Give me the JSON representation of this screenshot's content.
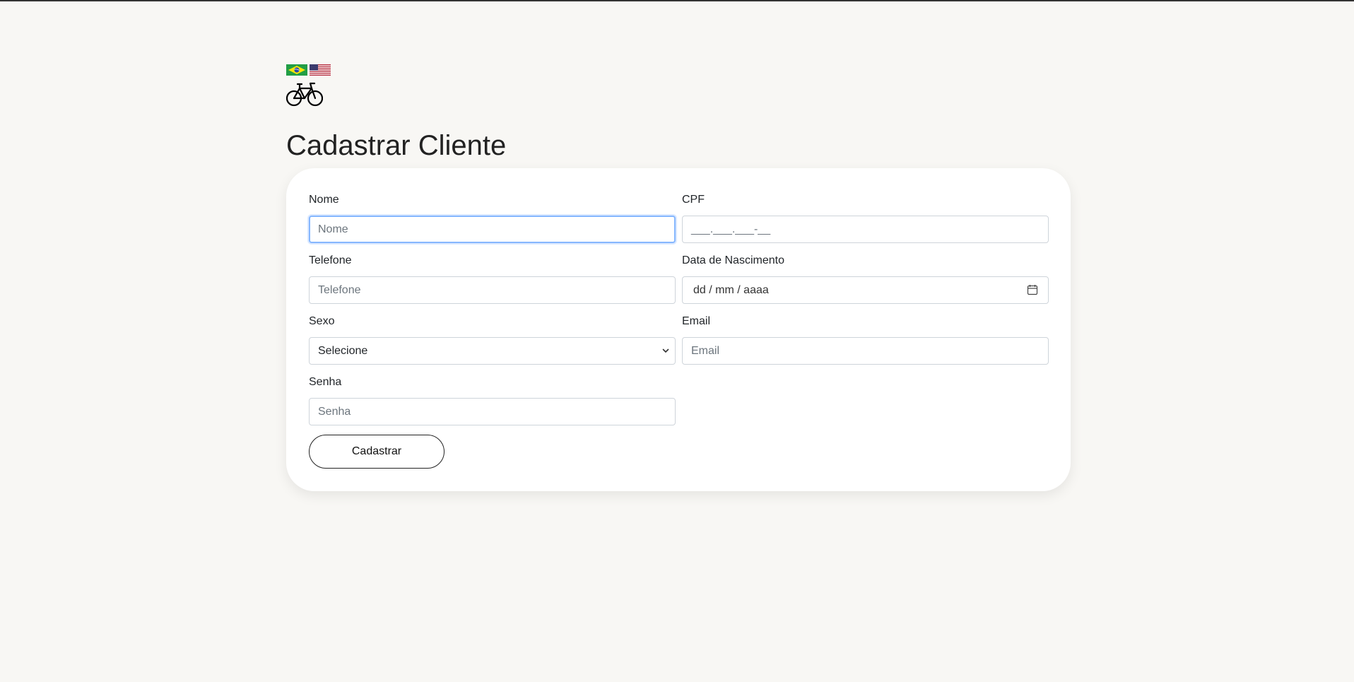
{
  "header": {
    "flags": [
      {
        "name": "brazil-flag-icon"
      },
      {
        "name": "usa-flag-icon"
      }
    ],
    "logo": "bicycle-icon"
  },
  "page": {
    "title": "Cadastrar Cliente"
  },
  "form": {
    "nome": {
      "label": "Nome",
      "placeholder": "Nome"
    },
    "cpf": {
      "label": "CPF",
      "placeholder": "___.___.___-__"
    },
    "telefone": {
      "label": "Telefone",
      "placeholder": "Telefone"
    },
    "nascimento": {
      "label": "Data de Nascimento",
      "dd": "dd",
      "mm": "mm",
      "aaaa": "aaaa",
      "sep": "/"
    },
    "sexo": {
      "label": "Sexo",
      "selected": "Selecione"
    },
    "email": {
      "label": "Email",
      "placeholder": "Email"
    },
    "senha": {
      "label": "Senha",
      "placeholder": "Senha"
    },
    "submit_label": "Cadastrar"
  },
  "colors": {
    "background": "#f8f7f4",
    "card": "#ffffff",
    "focus": "#86b7fe"
  }
}
